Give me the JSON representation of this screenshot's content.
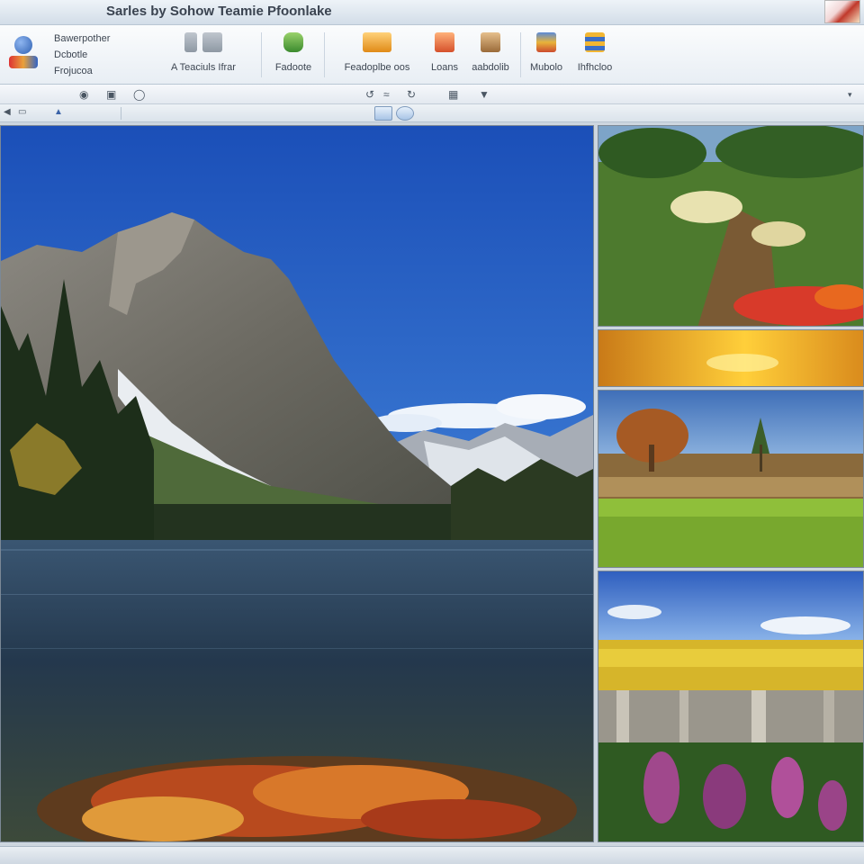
{
  "window": {
    "title": "Sarles by Sohow Teamie Pfoonlake"
  },
  "ribbon": {
    "menu": [
      "Bawerpother",
      "Dcbotle",
      "Frojucoa"
    ],
    "buttons": [
      {
        "label": "A Teaciuls Ifrar",
        "icon": "gallery-icon"
      },
      {
        "label": "Fadoote",
        "icon": "export-icon"
      },
      {
        "label": "Feadoplbe oos",
        "icon": "folder-icon"
      },
      {
        "label": "Loans",
        "icon": "image-icon"
      },
      {
        "label": "aabdolib",
        "icon": "edit-photo-icon"
      },
      {
        "label": "Mubolo",
        "icon": "media-icon"
      },
      {
        "label": "Ihfhcloo",
        "icon": "layers-icon"
      }
    ]
  },
  "toolbar": {
    "left_icons": [
      "lock-icon",
      "gear-icon",
      "info-icon"
    ],
    "center_icons": [
      "undo-icon",
      "link-icon",
      "rotate-icon",
      "grid-icon",
      "filter-icon"
    ],
    "right_icon": "chevron-down-icon"
  },
  "toolbar2": {
    "view_modes": [
      "single-view-icon",
      "refresh-icon"
    ]
  },
  "photos": {
    "main": "mountain-lake",
    "thumbnails": [
      "flower-garden",
      "sunset-sky",
      "autumn-meadow",
      "wildflower-field"
    ]
  },
  "status": {
    "text": ""
  }
}
